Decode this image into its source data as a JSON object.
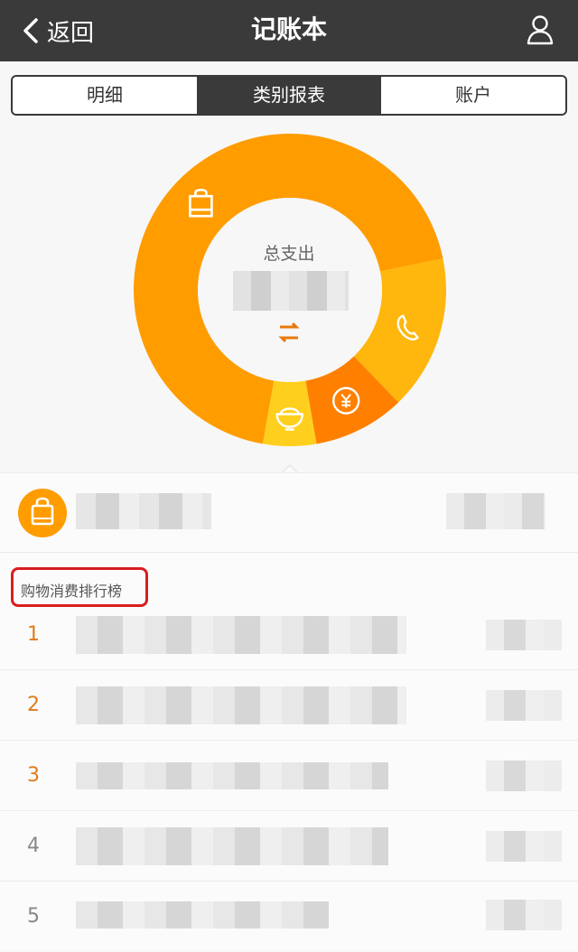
{
  "nav": {
    "back_label": "返回",
    "title": "记账本"
  },
  "tabs": [
    {
      "label": "明细",
      "active": false
    },
    {
      "label": "类别报表",
      "active": true
    },
    {
      "label": "账户",
      "active": false
    }
  ],
  "chart_data": {
    "type": "pie",
    "center_label": "总支出",
    "slices": [
      {
        "category_icon": "shopping-bag-icon",
        "share": 0.69,
        "color": "#ff9c00"
      },
      {
        "category_icon": "phone-icon",
        "share": 0.16,
        "color": "#ffb70e"
      },
      {
        "category_icon": "yen-icon",
        "share": 0.095,
        "color": "#ff8000"
      },
      {
        "category_icon": "rice-bowl-icon",
        "share": 0.055,
        "color": "#ffcf1d"
      }
    ]
  },
  "selected_category": {
    "icon": "shopping-bag-icon",
    "color": "#ff9c00"
  },
  "ranking": {
    "heading": "购物消费排行榜",
    "items": [
      {
        "rank": "1",
        "color": "#e07b1a"
      },
      {
        "rank": "2",
        "color": "#e07b1a"
      },
      {
        "rank": "3",
        "color": "#e07b1a"
      },
      {
        "rank": "4",
        "color": "#888888"
      },
      {
        "rank": "5",
        "color": "#888888"
      }
    ]
  },
  "colors": {
    "navbar": "#3a3a3a",
    "accent": "#ff9c00",
    "highlight_border": "#d81e1e"
  }
}
